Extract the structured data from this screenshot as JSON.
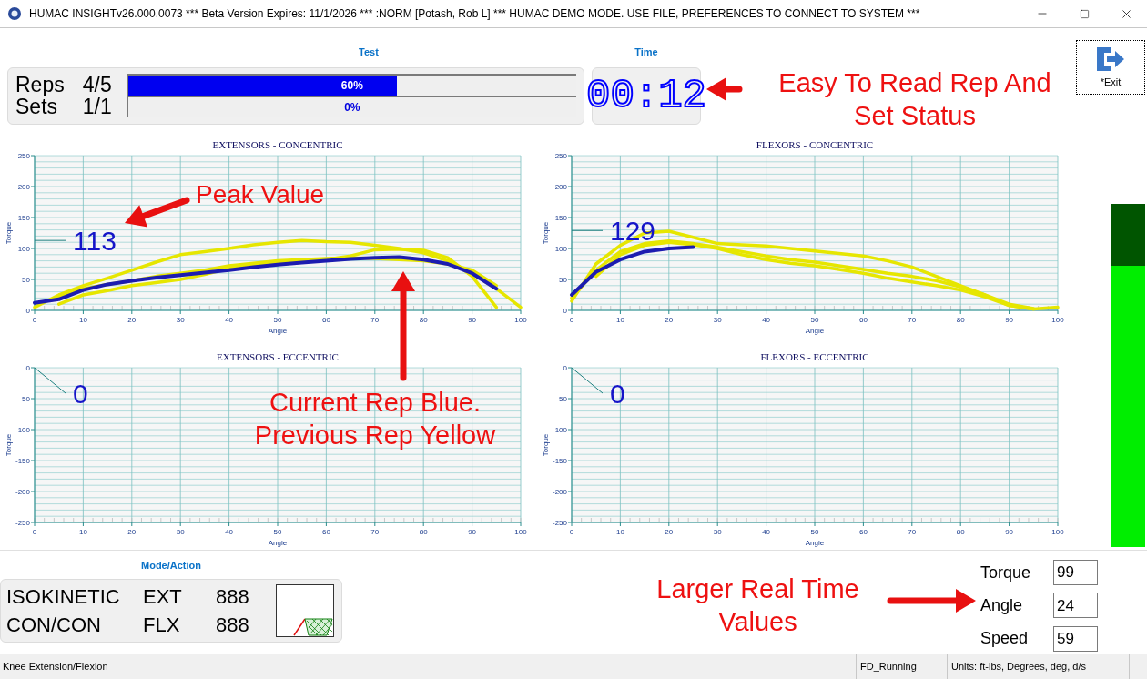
{
  "window": {
    "title": "HUMAC INSIGHTv26.000.0073 *** Beta Version Expires: 11/1/2026 *** :NORM [Potash, Rob L] *** HUMAC DEMO MODE. USE FILE, PREFERENCES TO CONNECT TO SYSTEM ***"
  },
  "test": {
    "heading": "Test",
    "counters": [
      {
        "label": "Reps",
        "value": "4/5"
      },
      {
        "label": "Sets",
        "value": "1/1"
      }
    ],
    "progress": [
      {
        "level": 0.6,
        "reading": "60%"
      },
      {
        "level": 0,
        "reading": "0%"
      }
    ]
  },
  "time": {
    "heading": "Time",
    "value": "00:12"
  },
  "exit_button": {
    "label": "*Exit"
  },
  "charts": [
    {
      "peak": "113",
      "chart_data": {
        "type": "line",
        "grid": true,
        "title": "EXTENSORS - CONCENTRIC",
        "xlabel": "Angle",
        "ylabel": "Torque",
        "x": [
          0,
          5,
          10,
          15,
          20,
          25,
          30,
          35,
          40,
          45,
          50,
          55,
          60,
          65,
          70,
          75,
          80,
          85,
          90,
          95,
          100
        ],
        "xlim": [
          0,
          100
        ],
        "ylim": [
          0,
          250
        ],
        "xticks": [
          0,
          10,
          20,
          30,
          40,
          50,
          60,
          70,
          80,
          90,
          100
        ],
        "yticks": [
          0,
          50,
          100,
          150,
          200,
          250
        ],
        "series": [
          {
            "color": "#e6e600",
            "values": [
              5,
              25,
              40,
              52,
              65,
              78,
              90,
              95,
              100,
              106,
              110,
              113,
              111,
              110,
              105,
              100,
              93,
              80,
              60,
              35,
              5
            ]
          },
          {
            "color": "#e6e600",
            "values": [
              null,
              10,
              25,
              32,
              40,
              45,
              50,
              58,
              68,
              74,
              78,
              80,
              82,
              88,
              98,
              99,
              97,
              85,
              55,
              5,
              null
            ]
          },
          {
            "color": "#e6e600",
            "values": [
              null,
              22,
              35,
              42,
              48,
              55,
              60,
              65,
              72,
              76,
              80,
              82,
              84,
              85,
              84,
              82,
              80,
              75,
              65,
              40,
              null
            ]
          },
          {
            "color": "#1c1cb0",
            "values": [
              12,
              18,
              33,
              42,
              48,
              53,
              57,
              61,
              65,
              70,
              74,
              77,
              80,
              83,
              85,
              86,
              82,
              75,
              60,
              35,
              null
            ]
          }
        ]
      }
    },
    {
      "peak": "129",
      "chart_data": {
        "type": "line",
        "grid": true,
        "title": "FLEXORS - CONCENTRIC",
        "xlabel": "Angle",
        "ylabel": "Torque",
        "x": [
          0,
          5,
          10,
          15,
          20,
          25,
          30,
          35,
          40,
          45,
          50,
          55,
          60,
          65,
          70,
          75,
          80,
          85,
          90,
          95,
          100
        ],
        "xlim": [
          0,
          100
        ],
        "ylim": [
          0,
          250
        ],
        "xticks": [
          0,
          10,
          20,
          30,
          40,
          50,
          60,
          70,
          80,
          90,
          100
        ],
        "yticks": [
          0,
          50,
          100,
          150,
          200,
          250
        ],
        "series": [
          {
            "color": "#e6e600",
            "values": [
              15,
              75,
              105,
              125,
              128,
              118,
              108,
              106,
              104,
              100,
              96,
              92,
              88,
              80,
              70,
              55,
              40,
              25,
              8,
              2,
              null
            ]
          },
          {
            "color": "#e6e600",
            "values": [
              20,
              65,
              95,
              108,
              112,
              108,
              102,
              95,
              88,
              82,
              78,
              72,
              66,
              60,
              55,
              48,
              38,
              25,
              10,
              3,
              null
            ]
          },
          {
            "color": "#e6e600",
            "values": [
              null,
              55,
              90,
              105,
              110,
              106,
              100,
              90,
              82,
              76,
              72,
              66,
              60,
              52,
              46,
              40,
              33,
              22,
              8,
              2,
              5
            ]
          },
          {
            "color": "#1c1cb0",
            "values": [
              25,
              62,
              82,
              95,
              100,
              102,
              null,
              null,
              null,
              null,
              null,
              null,
              null,
              null,
              null,
              null,
              null,
              null,
              null,
              null,
              null
            ]
          }
        ]
      }
    },
    {
      "peak": "0",
      "chart_data": {
        "type": "line",
        "grid": true,
        "title": "EXTENSORS - ECCENTRIC",
        "xlabel": "Angle",
        "ylabel": "Torque",
        "xlim": [
          0,
          100
        ],
        "ylim": [
          -250,
          0
        ],
        "xticks": [
          0,
          10,
          20,
          30,
          40,
          50,
          60,
          70,
          80,
          90,
          100
        ],
        "yticks": [
          -250,
          -200,
          -150,
          -100,
          -50,
          0
        ]
      }
    },
    {
      "peak": "0",
      "chart_data": {
        "type": "line",
        "grid": true,
        "title": "FLEXORS - ECCENTRIC",
        "xlabel": "Angle",
        "ylabel": "Torque",
        "xlim": [
          0,
          100
        ],
        "ylim": [
          -250,
          0
        ],
        "xticks": [
          0,
          10,
          20,
          30,
          40,
          50,
          60,
          70,
          80,
          90,
          100
        ],
        "yticks": [
          -250,
          -200,
          -150,
          -100,
          -50,
          0
        ]
      }
    }
  ],
  "meter": {
    "level": 0.82
  },
  "mode_action": {
    "heading": "Mode/Action",
    "rows": [
      {
        "mode": "ISOKINETIC",
        "direction": "EXT",
        "value": "888"
      },
      {
        "mode": "CON/CON",
        "direction": "FLX",
        "value": "888"
      }
    ]
  },
  "realtime": [
    {
      "label": "Torque",
      "value": "99"
    },
    {
      "label": "Angle",
      "value": "24"
    },
    {
      "label": "Speed",
      "value": "59"
    }
  ],
  "callouts": {
    "rep_status": "Easy To Read Rep And Set Status",
    "peak": "Peak Value",
    "colors": "Current Rep Blue. Previous Rep Yellow",
    "realtime": "Larger Real Time Values"
  },
  "status_bar": [
    "Knee Extension/Flexion",
    "FD_Running",
    "Units: ft-lbs, Degrees, deg, d/s"
  ]
}
